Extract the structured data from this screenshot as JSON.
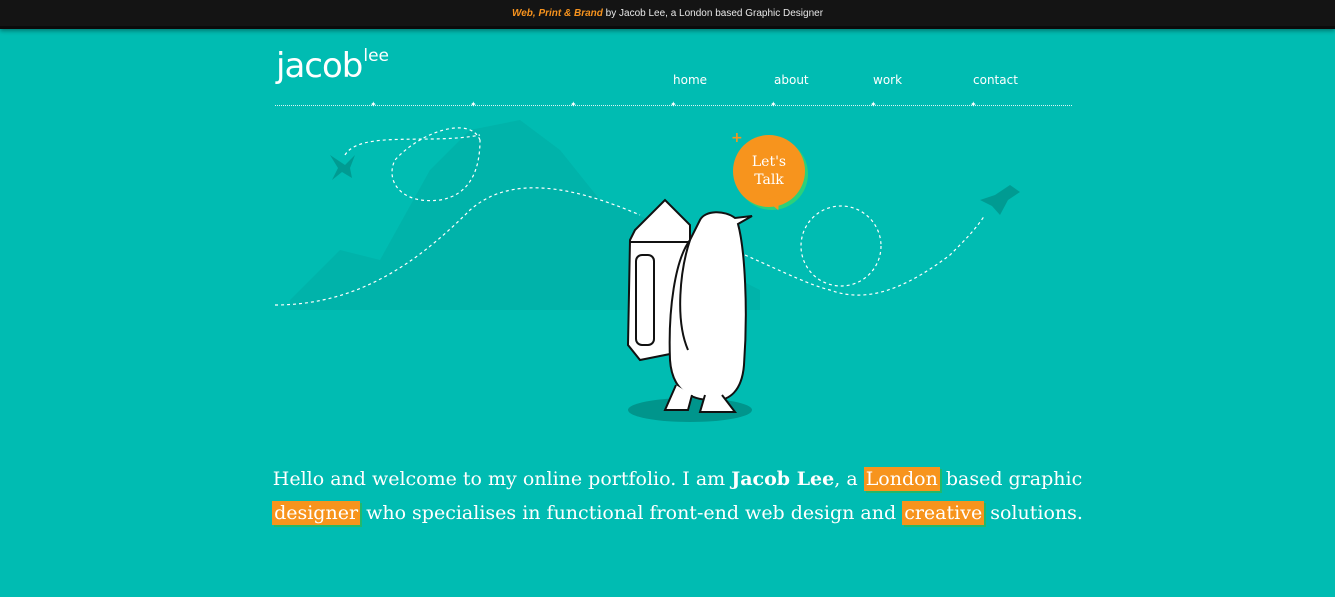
{
  "topbar": {
    "accent": "Web, Print & Brand",
    "rest": "by Jacob Lee, a London based Graphic Designer"
  },
  "logo": {
    "first": "jacob",
    "last": "lee"
  },
  "nav": [
    {
      "label": "home"
    },
    {
      "label": "about"
    },
    {
      "label": "work"
    },
    {
      "label": "contact"
    }
  ],
  "cta": {
    "line1": "Let's",
    "line2": "Talk"
  },
  "intro": {
    "p1": "Hello and welcome to my online portfolio. I am ",
    "name": "Jacob Lee",
    "p2": ", a ",
    "hl1": "London",
    "p3": " based graphic ",
    "hl2": "designer",
    "p4": " who specialises in functional front-end web design and ",
    "hl3": "creative",
    "p5": " solutions."
  },
  "colors": {
    "background": "#00bcb2",
    "accent": "#f7941d",
    "highlight_shadow": "#22b86c",
    "topbar": "#141414"
  },
  "icons": [
    "bird-icon",
    "plus-icon"
  ]
}
